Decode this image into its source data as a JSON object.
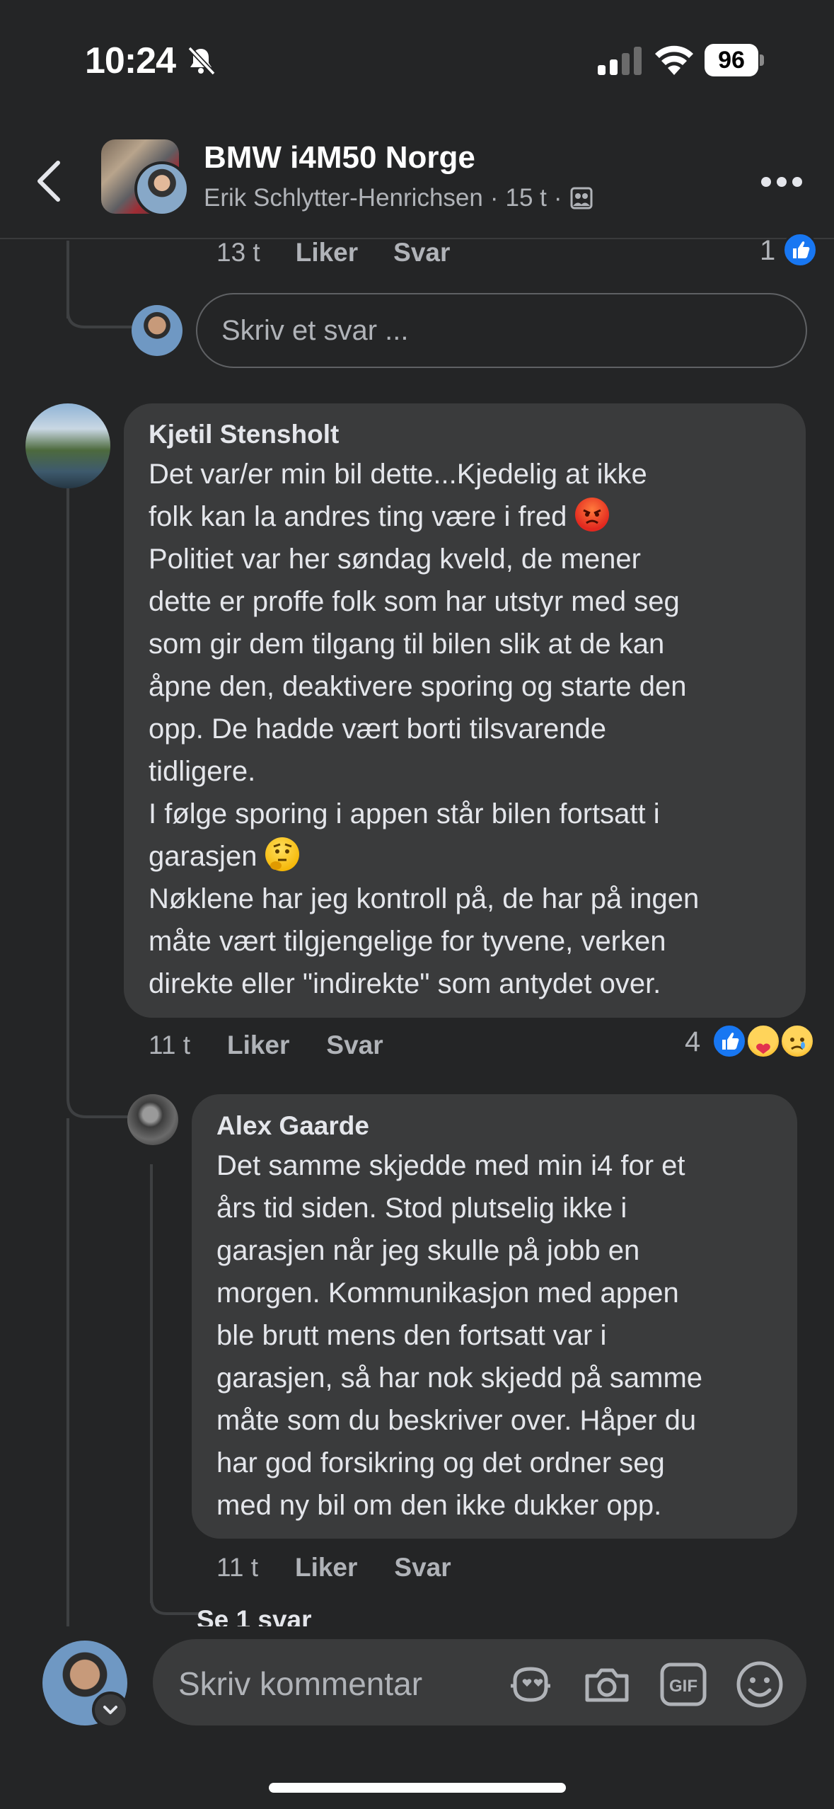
{
  "status_bar": {
    "time": "10:24",
    "battery": "96"
  },
  "header": {
    "group_title": "BMW i4M50 Norge",
    "poster": "Erik Schlytter-Henrichsen",
    "time_ago": "15 t",
    "separator": "·"
  },
  "prev_reply": {
    "time": "13 t",
    "like": "Liker",
    "reply": "Svar",
    "reaction_count": "1"
  },
  "reply_input": {
    "placeholder": "Skriv et svar ..."
  },
  "comments": [
    {
      "author": "Kjetil Stensholt",
      "text_part1": "Det var/er min bil dette...Kjedelig at ikke\nfolk kan la andres ting være i fred ",
      "emoji1": "angry-face",
      "text_part2": "\nPolitiet var her søndag kveld, de mener\ndette er proffe folk som har utstyr med seg\nsom gir dem tilgang til bilen slik at de kan\nåpne den, deaktivere sporing og starte den\nopp. De hadde vært borti tilsvarende\ntidligere.\nI følge sporing i appen står bilen fortsatt i\ngarasjen ",
      "emoji2": "thinking-face",
      "text_part3": "\nNøklene har jeg kontroll på, de har på ingen\nmåte vært tilgjengelige for tyvene, verken\ndirekte eller \"indirekte\" som antydet over.",
      "time": "11 t",
      "like": "Liker",
      "reply": "Svar",
      "reaction_count": "4"
    },
    {
      "author": "Alex Gaarde",
      "text": "Det samme skjedde med min i4 for et\nårs tid siden. Stod plutselig ikke i\ngarasjen når jeg skulle på jobb en\nmorgen. Kommunikasjon med appen\nble brutt mens den fortsatt var i\ngarasjen, så har nok skjedd på samme\nmåte som du beskriver over. Håper du\nhar god forsikring og det ordner seg\nmed ny bil om den ikke dukker opp.",
      "time": "11 t",
      "like": "Liker",
      "reply": "Svar"
    }
  ],
  "see_replies": "Se 1 svar",
  "composer": {
    "placeholder": "Skriv kommentar",
    "icons": [
      "avatar-sticker-icon",
      "camera-icon",
      "gif-icon",
      "emoji-icon"
    ]
  },
  "colors": {
    "background": "#242526",
    "bubble": "#3a3b3c",
    "like_blue": "#1877f2",
    "muted_text": "#b0b3b8"
  }
}
